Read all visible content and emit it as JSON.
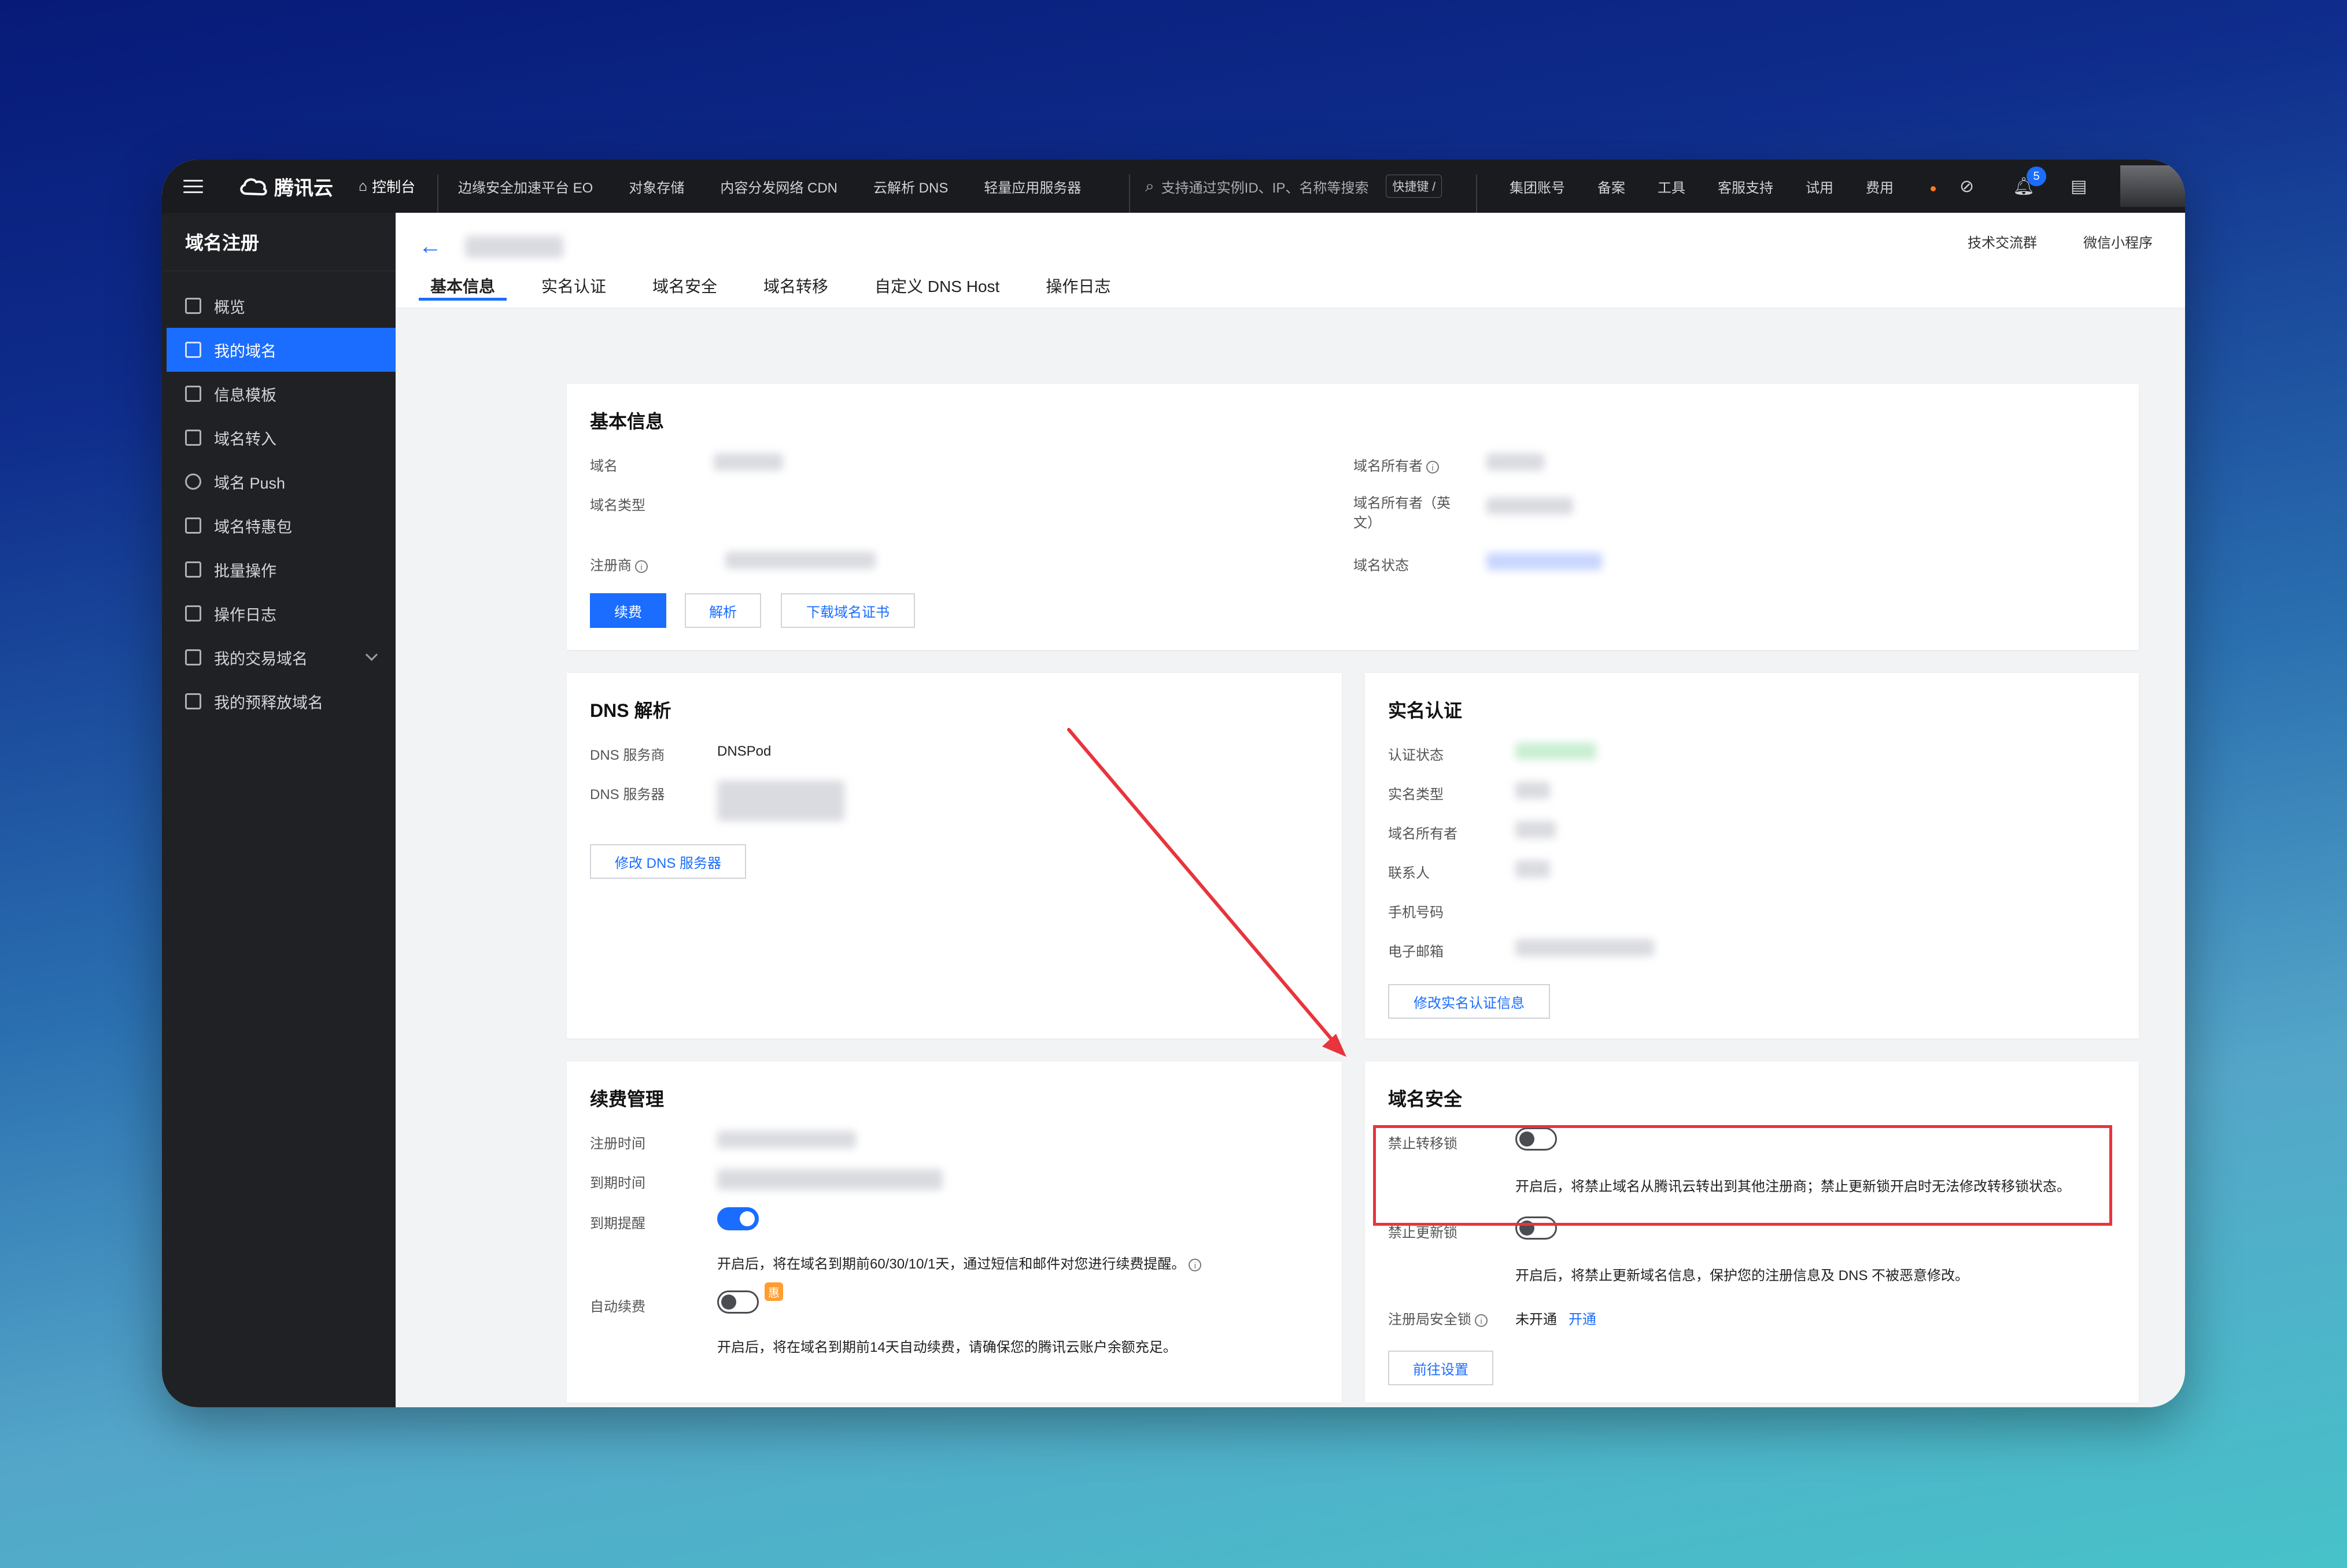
{
  "topbar": {
    "brand": "腾讯云",
    "console": "控制台",
    "nav": [
      "边缘安全加速平台 EO",
      "对象存储",
      "内容分发网络 CDN",
      "云解析 DNS",
      "轻量应用服务器"
    ],
    "search_placeholder": "支持通过实例ID、IP、名称等搜索",
    "search_shortcut": "快捷键 /",
    "right_links": [
      "集团账号",
      "备案",
      "工具",
      "客服支持",
      "试用",
      "费用"
    ],
    "notification_count": "5"
  },
  "sidebar": {
    "title": "域名注册",
    "items": [
      {
        "label": "概览"
      },
      {
        "label": "我的域名"
      },
      {
        "label": "信息模板"
      },
      {
        "label": "域名转入"
      },
      {
        "label": "域名 Push"
      },
      {
        "label": "域名特惠包"
      },
      {
        "label": "批量操作"
      },
      {
        "label": "操作日志"
      },
      {
        "label": "我的交易域名"
      },
      {
        "label": "我的预释放域名"
      }
    ],
    "active_index": 1
  },
  "header": {
    "links": [
      "技术交流群",
      "微信小程序"
    ],
    "tabs": [
      "基本信息",
      "实名认证",
      "域名安全",
      "域名转移",
      "自定义 DNS Host",
      "操作日志"
    ],
    "active_tab": 0
  },
  "basic": {
    "title": "基本信息",
    "domain_label": "域名",
    "type_label": "域名类型",
    "registrar_label": "注册商",
    "owner_label": "域名所有者",
    "owner_en_label": "域名所有者（英文）",
    "status_label": "域名状态",
    "btn_renew": "续费",
    "btn_resolve": "解析",
    "btn_cert": "下载域名证书"
  },
  "dns": {
    "title": "DNS 解析",
    "provider_label": "DNS 服务商",
    "provider_value": "DNSPod",
    "server_label": "DNS 服务器",
    "btn_modify": "修改 DNS 服务器"
  },
  "realname": {
    "title": "实名认证",
    "labels": [
      "认证状态",
      "实名类型",
      "域名所有者",
      "联系人",
      "手机号码",
      "电子邮箱"
    ],
    "btn_modify": "修改实名认证信息"
  },
  "renewal": {
    "title": "续费管理",
    "reg_time_label": "注册时间",
    "exp_time_label": "到期时间",
    "reminder_label": "到期提醒",
    "reminder_on": true,
    "reminder_desc": "开启后，将在域名到期前60/30/10/1天，通过短信和邮件对您进行续费提醒。",
    "auto_label": "自动续费",
    "auto_on": false,
    "auto_badge": "惠",
    "auto_desc": "开启后，将在域名到期前14天自动续费，请确保您的腾讯云账户余额充足。"
  },
  "security": {
    "title": "域名安全",
    "transfer_lock_label": "禁止转移锁",
    "transfer_lock_on": false,
    "transfer_lock_desc": "开启后，将禁止域名从腾讯云转出到其他注册商；禁止更新锁开启时无法修改转移锁状态。",
    "update_lock_label": "禁止更新锁",
    "update_lock_on": false,
    "update_lock_desc": "开启后，将禁止更新域名信息，保护您的注册信息及 DNS 不被恶意修改。",
    "registry_lock_label": "注册局安全锁",
    "registry_lock_status": "未开通",
    "registry_lock_action": "开通",
    "btn_setup": "前往设置"
  },
  "colors": {
    "accent": "#1a6dff",
    "highlight": "#e8343c"
  }
}
